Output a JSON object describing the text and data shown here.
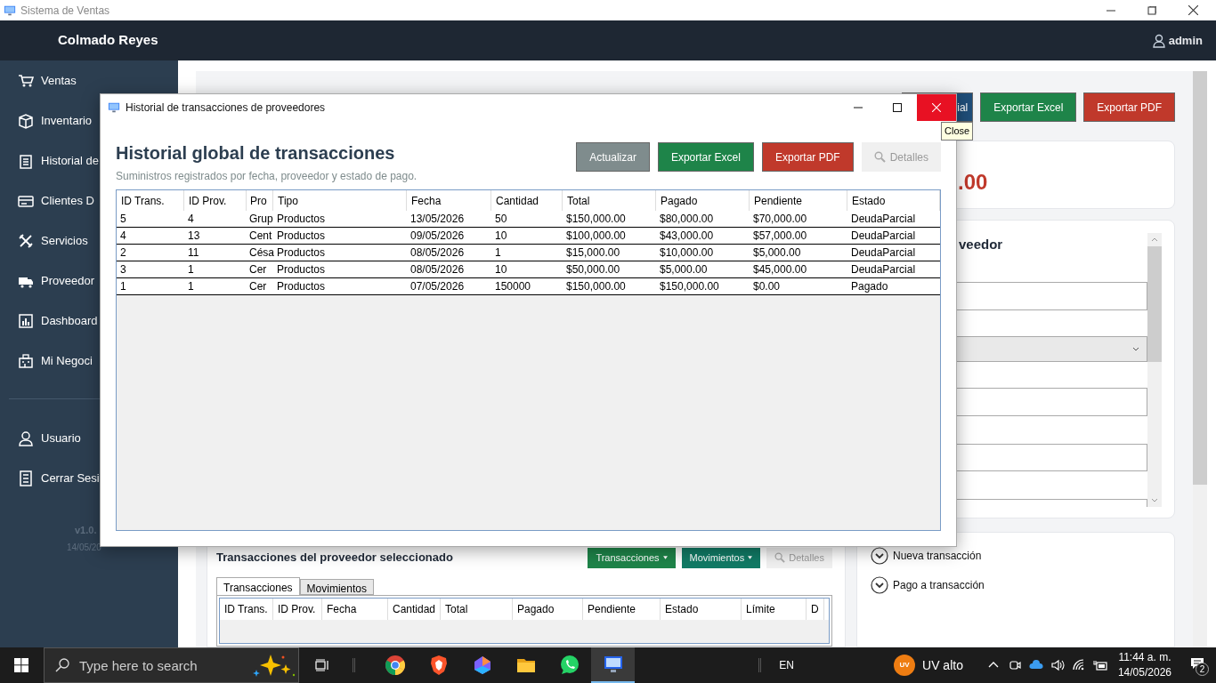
{
  "app_window": {
    "title": "Sistema de Ventas"
  },
  "header": {
    "business": "Colmado Reyes",
    "user": "admin"
  },
  "sidebar": {
    "items": [
      {
        "label": "Ventas"
      },
      {
        "label": "Inventario"
      },
      {
        "label": "Historial de"
      },
      {
        "label": "Clientes D"
      },
      {
        "label": "Servicios"
      },
      {
        "label": "Proveedor"
      },
      {
        "label": "Dashboard"
      },
      {
        "label": "Mi Negoci"
      }
    ],
    "footer_items": [
      {
        "label": "Usuario"
      },
      {
        "label": "Cerrar Sesi"
      }
    ],
    "version": "v1.0.",
    "date": "14/05/20"
  },
  "page": {
    "top_buttons": [
      {
        "label": "ial",
        "kind": "primary"
      },
      {
        "label": "Exportar Excel",
        "kind": "success"
      },
      {
        "label": "Exportar PDF",
        "kind": "danger"
      }
    ],
    "summary_value": ".00",
    "form_title": "veedor",
    "supplier_transactions": {
      "title": "Transacciones del proveedor seleccionado",
      "buttons": [
        {
          "label": "Transacciones",
          "kind": "success",
          "dropdown": true,
          "disabled": false
        },
        {
          "label": "Movimientos",
          "kind": "teal",
          "dropdown": true,
          "disabled": false
        },
        {
          "label": "Detalles",
          "kind": "search",
          "dropdown": false,
          "disabled": true
        }
      ],
      "tabs": [
        {
          "label": "Transacciones",
          "selected": true
        },
        {
          "label": "Movimientos",
          "selected": false
        }
      ],
      "columns": [
        "ID Trans.",
        "ID Prov.",
        "Fecha",
        "Cantidad",
        "Total",
        "Pagado",
        "Pendiente",
        "Estado",
        "Límite",
        "D"
      ]
    },
    "actions": [
      {
        "label": "Nueva transacción",
        "expanded": false
      },
      {
        "label": "Pago a transacción",
        "expanded": false
      }
    ]
  },
  "tooltip": "Close",
  "dialog": {
    "title": "Historial de transacciones de proveedores",
    "heading": "Historial global de transacciones",
    "subtitle": "Suministros registrados por fecha, proveedor y estado de pago.",
    "buttons": [
      {
        "label": "Actualizar",
        "kind": "neutral",
        "disabled": false
      },
      {
        "label": "Exportar Excel",
        "kind": "success",
        "disabled": false
      },
      {
        "label": "Exportar PDF",
        "kind": "danger",
        "disabled": false
      },
      {
        "label": "Detalles",
        "kind": "search",
        "disabled": true
      }
    ],
    "columns": [
      "ID Trans.",
      "ID Prov.",
      "Pro",
      "Tipo",
      "Fecha",
      "Cantidad",
      "Total",
      "Pagado",
      "Pendiente",
      "Estado"
    ],
    "rows": [
      [
        "5",
        "4",
        "Grup",
        "Productos",
        "13/05/2026",
        "50",
        "$150,000.00",
        "$80,000.00",
        "$70,000.00",
        "DeudaParcial"
      ],
      [
        "4",
        "13",
        "Cent",
        "Productos",
        "09/05/2026",
        "10",
        "$100,000.00",
        "$43,000.00",
        "$57,000.00",
        "DeudaParcial"
      ],
      [
        "2",
        "11",
        "Césa",
        "Productos",
        "08/05/2026",
        "1",
        "$15,000.00",
        "$10,000.00",
        "$5,000.00",
        "DeudaParcial"
      ],
      [
        "3",
        "1",
        "Cer",
        "Productos",
        "08/05/2026",
        "10",
        "$50,000.00",
        "$5,000.00",
        "$45,000.00",
        "DeudaParcial"
      ],
      [
        "1",
        "1",
        "Cer",
        "Productos",
        "07/05/2026",
        "150000",
        "$150,000.00",
        "$150,000.00",
        "$0.00",
        "Pagado"
      ]
    ]
  },
  "taskbar": {
    "search_placeholder": "Type here to search",
    "apps": [
      {
        "selected": false
      },
      {
        "selected": false
      },
      {
        "selected": false
      },
      {
        "selected": false
      },
      {
        "selected": false
      },
      {
        "selected": true
      }
    ],
    "language": "EN",
    "weather_badge": "UV",
    "weather_text": "UV alto",
    "time": "11:44 a. m.",
    "date": "14/05/2026",
    "notifications": "2"
  }
}
